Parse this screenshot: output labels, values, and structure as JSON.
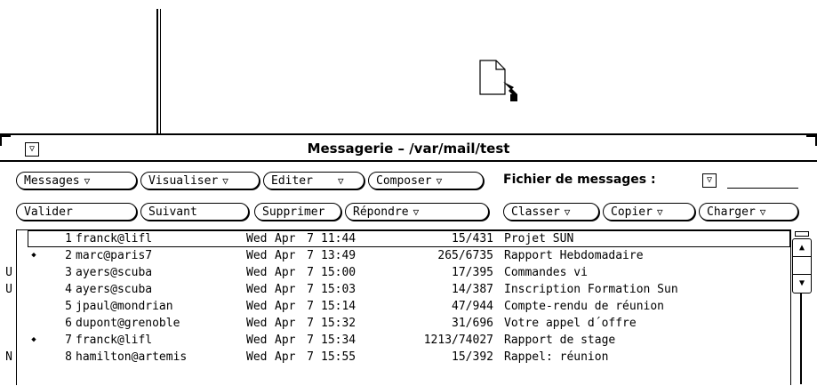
{
  "window": {
    "title": "Messagerie – /var/mail/test",
    "menu_glyph": "▽"
  },
  "toolbar": {
    "row1": [
      {
        "label": "Messages",
        "menu": "▽"
      },
      {
        "label": "Visualiser",
        "menu": "▽"
      },
      {
        "label": "Editer",
        "menu": "▽"
      },
      {
        "label": "Composer",
        "menu": "▽"
      }
    ],
    "row2": [
      {
        "label": "Valider"
      },
      {
        "label": "Suivant"
      },
      {
        "label": "Supprimer"
      },
      {
        "label": "Répondre",
        "menu": "▽"
      },
      {
        "label": "Classer",
        "menu": "▽"
      },
      {
        "label": "Copier",
        "menu": "▽"
      },
      {
        "label": "Charger",
        "menu": "▽"
      }
    ],
    "file_label": "Fichier de messages :",
    "file_menu": "▽",
    "file_value": ""
  },
  "messages": [
    {
      "flag": "",
      "num": "1",
      "from": "franck@lifl",
      "day": "Wed",
      "mon": "Apr",
      "date": "7",
      "time": "11:44",
      "size": "15/431",
      "subject": "Projet SUN",
      "selected": true
    },
    {
      "flag": "◆",
      "num": "2",
      "from": "marc@paris7",
      "day": "Wed",
      "mon": "Apr",
      "date": "7",
      "time": "13:49",
      "size": "265/6735",
      "subject": "Rapport Hebdomadaire"
    },
    {
      "flag": "U",
      "num": "3",
      "from": "ayers@scuba",
      "day": "Wed",
      "mon": "Apr",
      "date": "7",
      "time": "15:00",
      "size": "17/395",
      "subject": "Commandes vi"
    },
    {
      "flag": "U",
      "num": "4",
      "from": "ayers@scuba",
      "day": "Wed",
      "mon": "Apr",
      "date": "7",
      "time": "15:03",
      "size": "14/387",
      "subject": "Inscription Formation Sun"
    },
    {
      "flag": "",
      "num": "5",
      "from": "jpaul@mondrian",
      "day": "Wed",
      "mon": "Apr",
      "date": "7",
      "time": "15:14",
      "size": "47/944",
      "subject": "Compte-rendu de réunion"
    },
    {
      "flag": "",
      "num": "6",
      "from": "dupont@grenoble",
      "day": "Wed",
      "mon": "Apr",
      "date": "7",
      "time": "15:32",
      "size": "31/696",
      "subject": "Votre appel d´offre"
    },
    {
      "flag": "◆",
      "num": "7",
      "from": "franck@lifl",
      "day": "Wed",
      "mon": "Apr",
      "date": "7",
      "time": "15:34",
      "size": "1213/74027",
      "subject": "Rapport de stage"
    },
    {
      "flag": "N",
      "num": "8",
      "from": "hamilton@artemis",
      "day": "Wed",
      "mon": "Apr",
      "date": "7",
      "time": "15:55",
      "size": "15/392",
      "subject": "Rappel: réunion"
    }
  ],
  "scrollbar": {
    "up": "▲",
    "down": "▼"
  },
  "colors": {
    "background": "#ffffff",
    "ink": "#000000"
  }
}
